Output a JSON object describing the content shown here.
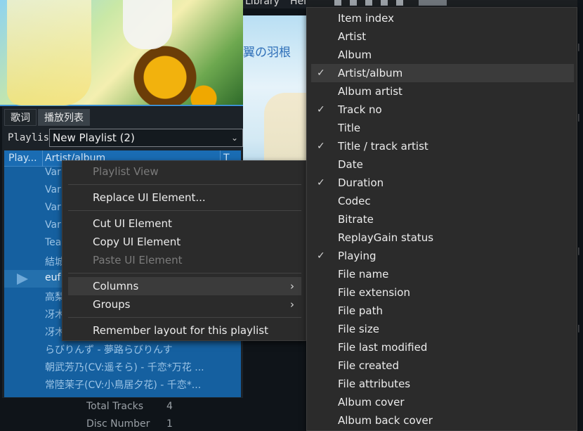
{
  "menubar": {
    "library": "Library",
    "help": "Help"
  },
  "artwork_right": {
    "title_text": "翼の羽根"
  },
  "playlist_panel": {
    "tabs": [
      {
        "label": "歌词"
      },
      {
        "label": "播放列表"
      }
    ],
    "playlist_label": "Playlis",
    "playlist_select_value": "New Playlist (2)",
    "columns": [
      "Play...",
      "Artist/album",
      "T"
    ],
    "rows": [
      {
        "text": "Var"
      },
      {
        "text": "Var"
      },
      {
        "text": "Var"
      },
      {
        "text": "Var"
      },
      {
        "text": "Tea"
      },
      {
        "text": "結城"
      },
      {
        "text": "euf"
      },
      {
        "text": "高梨"
      },
      {
        "text": "冴木"
      },
      {
        "text": "冴木"
      },
      {
        "text": "らびりんず - 夢路らびりんす"
      },
      {
        "text": "朝武芳乃(CV:遥そら) - 千恋*万花 ..."
      },
      {
        "text": "常陸茉子(CV:小鳥居夕花) - 千恋*..."
      }
    ]
  },
  "info": [
    {
      "label": "Total Tracks",
      "value": "4"
    },
    {
      "label": "Disc Number",
      "value": "1"
    }
  ],
  "context_menu": {
    "header": "Playlist View",
    "replace": "Replace UI Element...",
    "cut": "Cut UI Element",
    "copy": "Copy UI Element",
    "paste": "Paste UI Element",
    "columns": "Columns",
    "groups": "Groups",
    "remember": "Remember layout for this playlist"
  },
  "columns_submenu": {
    "items": [
      {
        "label": "Item index",
        "checked": false
      },
      {
        "label": "Artist",
        "checked": false
      },
      {
        "label": "Album",
        "checked": false
      },
      {
        "label": "Artist/album",
        "checked": true
      },
      {
        "label": "Album artist",
        "checked": false
      },
      {
        "label": "Track no",
        "checked": true
      },
      {
        "label": "Title",
        "checked": false
      },
      {
        "label": "Title / track artist",
        "checked": true
      },
      {
        "label": "Date",
        "checked": false
      },
      {
        "label": "Duration",
        "checked": true
      },
      {
        "label": "Codec",
        "checked": false
      },
      {
        "label": "Bitrate",
        "checked": false
      },
      {
        "label": "ReplayGain status",
        "checked": false
      },
      {
        "label": "Playing",
        "checked": true
      },
      {
        "label": "File name",
        "checked": false
      },
      {
        "label": "File extension",
        "checked": false
      },
      {
        "label": "File path",
        "checked": false
      },
      {
        "label": "File size",
        "checked": false
      },
      {
        "label": "File last modified",
        "checked": false
      },
      {
        "label": "File created",
        "checked": false
      },
      {
        "label": "File attributes",
        "checked": false
      },
      {
        "label": "Album cover",
        "checked": false
      },
      {
        "label": "Album back cover",
        "checked": false
      }
    ],
    "check_glyph": "✓"
  },
  "colors": {
    "accent": "#1560a0",
    "menu_bg": "#2b2b2b",
    "highlight": "#3b3b3b"
  }
}
